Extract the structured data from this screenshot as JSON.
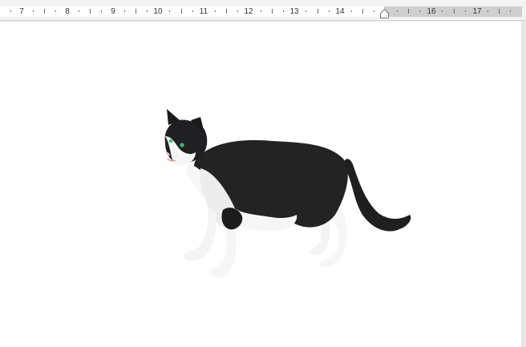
{
  "ruler": {
    "numbers": [
      "7",
      "8",
      "9",
      "10",
      "11",
      "12",
      "13",
      "14",
      "16",
      "17"
    ],
    "active_color": "#ffffff",
    "inactive_color": "#cfcfcf"
  },
  "page": {
    "background": "#ffffff",
    "image": {
      "subject": "cat-photo",
      "colors": {
        "fur_dark": "#1e1e20",
        "fur_white": "#f6f6f6",
        "eyes": "#3fb96a",
        "nose": "#e8b7b2"
      }
    }
  },
  "icons": [
    "indent-marker-icon"
  ]
}
